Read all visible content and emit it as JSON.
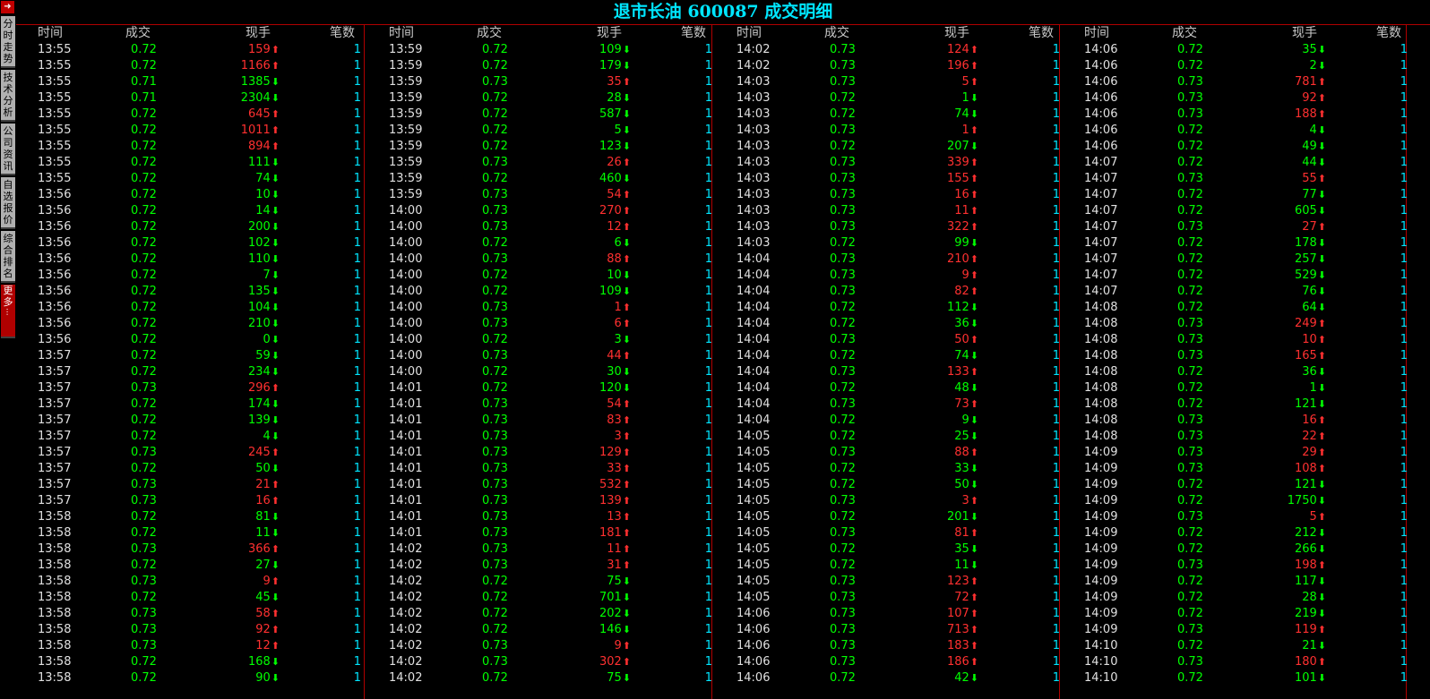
{
  "title": "退市长油 600087 成交明细",
  "sidebar": {
    "tabs": [
      "分时走势",
      "技术分析",
      "公司资讯",
      "自选报价",
      "综合排名"
    ],
    "more": "更多..."
  },
  "headers": {
    "time": "时间",
    "price": "成交",
    "volume": "现手",
    "count": "笔数"
  },
  "colors": {
    "up": "#ff3030",
    "down": "#00ff00",
    "title": "#00e6ff",
    "divider": "#b00000"
  },
  "panels": [
    [
      [
        "13:55",
        "0.72",
        "159",
        "up",
        "1"
      ],
      [
        "13:55",
        "0.72",
        "1166",
        "up",
        "1"
      ],
      [
        "13:55",
        "0.71",
        "1385",
        "down",
        "1"
      ],
      [
        "13:55",
        "0.71",
        "2304",
        "down",
        "1"
      ],
      [
        "13:55",
        "0.72",
        "645",
        "up",
        "1"
      ],
      [
        "13:55",
        "0.72",
        "1011",
        "up",
        "1"
      ],
      [
        "13:55",
        "0.72",
        "894",
        "up",
        "1"
      ],
      [
        "13:55",
        "0.72",
        "111",
        "down",
        "1"
      ],
      [
        "13:55",
        "0.72",
        "74",
        "down",
        "1"
      ],
      [
        "13:56",
        "0.72",
        "10",
        "down",
        "1"
      ],
      [
        "13:56",
        "0.72",
        "14",
        "down",
        "1"
      ],
      [
        "13:56",
        "0.72",
        "200",
        "down",
        "1"
      ],
      [
        "13:56",
        "0.72",
        "102",
        "down",
        "1"
      ],
      [
        "13:56",
        "0.72",
        "110",
        "down",
        "1"
      ],
      [
        "13:56",
        "0.72",
        "7",
        "down",
        "1"
      ],
      [
        "13:56",
        "0.72",
        "135",
        "down",
        "1"
      ],
      [
        "13:56",
        "0.72",
        "104",
        "down",
        "1"
      ],
      [
        "13:56",
        "0.72",
        "210",
        "down",
        "1"
      ],
      [
        "13:56",
        "0.72",
        "0",
        "down",
        "1"
      ],
      [
        "13:57",
        "0.72",
        "59",
        "down",
        "1"
      ],
      [
        "13:57",
        "0.72",
        "234",
        "down",
        "1"
      ],
      [
        "13:57",
        "0.73",
        "296",
        "up",
        "1"
      ],
      [
        "13:57",
        "0.72",
        "174",
        "down",
        "1"
      ],
      [
        "13:57",
        "0.72",
        "139",
        "down",
        "1"
      ],
      [
        "13:57",
        "0.72",
        "4",
        "down",
        "1"
      ],
      [
        "13:57",
        "0.73",
        "245",
        "up",
        "1"
      ],
      [
        "13:57",
        "0.72",
        "50",
        "down",
        "1"
      ],
      [
        "13:57",
        "0.73",
        "21",
        "up",
        "1"
      ],
      [
        "13:57",
        "0.73",
        "16",
        "up",
        "1"
      ],
      [
        "13:58",
        "0.72",
        "81",
        "down",
        "1"
      ],
      [
        "13:58",
        "0.72",
        "11",
        "down",
        "1"
      ],
      [
        "13:58",
        "0.73",
        "366",
        "up",
        "1"
      ],
      [
        "13:58",
        "0.72",
        "27",
        "down",
        "1"
      ],
      [
        "13:58",
        "0.73",
        "9",
        "up",
        "1"
      ],
      [
        "13:58",
        "0.72",
        "45",
        "down",
        "1"
      ],
      [
        "13:58",
        "0.73",
        "58",
        "up",
        "1"
      ],
      [
        "13:58",
        "0.73",
        "92",
        "up",
        "1"
      ],
      [
        "13:58",
        "0.73",
        "12",
        "up",
        "1"
      ],
      [
        "13:58",
        "0.72",
        "168",
        "down",
        "1"
      ],
      [
        "13:58",
        "0.72",
        "90",
        "down",
        "1"
      ]
    ],
    [
      [
        "13:59",
        "0.72",
        "109",
        "down",
        "1"
      ],
      [
        "13:59",
        "0.72",
        "179",
        "down",
        "1"
      ],
      [
        "13:59",
        "0.73",
        "35",
        "up",
        "1"
      ],
      [
        "13:59",
        "0.72",
        "28",
        "down",
        "1"
      ],
      [
        "13:59",
        "0.72",
        "587",
        "down",
        "1"
      ],
      [
        "13:59",
        "0.72",
        "5",
        "down",
        "1"
      ],
      [
        "13:59",
        "0.72",
        "123",
        "down",
        "1"
      ],
      [
        "13:59",
        "0.73",
        "26",
        "up",
        "1"
      ],
      [
        "13:59",
        "0.72",
        "460",
        "down",
        "1"
      ],
      [
        "13:59",
        "0.73",
        "54",
        "up",
        "1"
      ],
      [
        "14:00",
        "0.73",
        "270",
        "up",
        "1"
      ],
      [
        "14:00",
        "0.73",
        "12",
        "up",
        "1"
      ],
      [
        "14:00",
        "0.72",
        "6",
        "down",
        "1"
      ],
      [
        "14:00",
        "0.73",
        "88",
        "up",
        "1"
      ],
      [
        "14:00",
        "0.72",
        "10",
        "down",
        "1"
      ],
      [
        "14:00",
        "0.72",
        "109",
        "down",
        "1"
      ],
      [
        "14:00",
        "0.73",
        "1",
        "up",
        "1"
      ],
      [
        "14:00",
        "0.73",
        "6",
        "up",
        "1"
      ],
      [
        "14:00",
        "0.72",
        "3",
        "down",
        "1"
      ],
      [
        "14:00",
        "0.73",
        "44",
        "up",
        "1"
      ],
      [
        "14:00",
        "0.72",
        "30",
        "down",
        "1"
      ],
      [
        "14:01",
        "0.72",
        "120",
        "down",
        "1"
      ],
      [
        "14:01",
        "0.73",
        "54",
        "up",
        "1"
      ],
      [
        "14:01",
        "0.73",
        "83",
        "up",
        "1"
      ],
      [
        "14:01",
        "0.73",
        "3",
        "up",
        "1"
      ],
      [
        "14:01",
        "0.73",
        "129",
        "up",
        "1"
      ],
      [
        "14:01",
        "0.73",
        "33",
        "up",
        "1"
      ],
      [
        "14:01",
        "0.73",
        "532",
        "up",
        "1"
      ],
      [
        "14:01",
        "0.73",
        "139",
        "up",
        "1"
      ],
      [
        "14:01",
        "0.73",
        "13",
        "up",
        "1"
      ],
      [
        "14:01",
        "0.73",
        "181",
        "up",
        "1"
      ],
      [
        "14:02",
        "0.73",
        "11",
        "up",
        "1"
      ],
      [
        "14:02",
        "0.73",
        "31",
        "up",
        "1"
      ],
      [
        "14:02",
        "0.72",
        "75",
        "down",
        "1"
      ],
      [
        "14:02",
        "0.72",
        "701",
        "down",
        "1"
      ],
      [
        "14:02",
        "0.72",
        "202",
        "down",
        "1"
      ],
      [
        "14:02",
        "0.72",
        "146",
        "down",
        "1"
      ],
      [
        "14:02",
        "0.73",
        "9",
        "up",
        "1"
      ],
      [
        "14:02",
        "0.73",
        "302",
        "up",
        "1"
      ],
      [
        "14:02",
        "0.72",
        "75",
        "down",
        "1"
      ]
    ],
    [
      [
        "14:02",
        "0.73",
        "124",
        "up",
        "1"
      ],
      [
        "14:02",
        "0.73",
        "196",
        "up",
        "1"
      ],
      [
        "14:03",
        "0.73",
        "5",
        "up",
        "1"
      ],
      [
        "14:03",
        "0.72",
        "1",
        "down",
        "1"
      ],
      [
        "14:03",
        "0.72",
        "74",
        "down",
        "1"
      ],
      [
        "14:03",
        "0.73",
        "1",
        "up",
        "1"
      ],
      [
        "14:03",
        "0.72",
        "207",
        "down",
        "1"
      ],
      [
        "14:03",
        "0.73",
        "339",
        "up",
        "1"
      ],
      [
        "14:03",
        "0.73",
        "155",
        "up",
        "1"
      ],
      [
        "14:03",
        "0.73",
        "16",
        "up",
        "1"
      ],
      [
        "14:03",
        "0.73",
        "11",
        "up",
        "1"
      ],
      [
        "14:03",
        "0.73",
        "322",
        "up",
        "1"
      ],
      [
        "14:03",
        "0.72",
        "99",
        "down",
        "1"
      ],
      [
        "14:04",
        "0.73",
        "210",
        "up",
        "1"
      ],
      [
        "14:04",
        "0.73",
        "9",
        "up",
        "1"
      ],
      [
        "14:04",
        "0.73",
        "82",
        "up",
        "1"
      ],
      [
        "14:04",
        "0.72",
        "112",
        "down",
        "1"
      ],
      [
        "14:04",
        "0.72",
        "36",
        "down",
        "1"
      ],
      [
        "14:04",
        "0.73",
        "50",
        "up",
        "1"
      ],
      [
        "14:04",
        "0.72",
        "74",
        "down",
        "1"
      ],
      [
        "14:04",
        "0.73",
        "133",
        "up",
        "1"
      ],
      [
        "14:04",
        "0.72",
        "48",
        "down",
        "1"
      ],
      [
        "14:04",
        "0.73",
        "73",
        "up",
        "1"
      ],
      [
        "14:04",
        "0.72",
        "9",
        "down",
        "1"
      ],
      [
        "14:05",
        "0.72",
        "25",
        "down",
        "1"
      ],
      [
        "14:05",
        "0.73",
        "88",
        "up",
        "1"
      ],
      [
        "14:05",
        "0.72",
        "33",
        "down",
        "1"
      ],
      [
        "14:05",
        "0.72",
        "50",
        "down",
        "1"
      ],
      [
        "14:05",
        "0.73",
        "3",
        "up",
        "1"
      ],
      [
        "14:05",
        "0.72",
        "201",
        "down",
        "1"
      ],
      [
        "14:05",
        "0.73",
        "81",
        "up",
        "1"
      ],
      [
        "14:05",
        "0.72",
        "35",
        "down",
        "1"
      ],
      [
        "14:05",
        "0.72",
        "11",
        "down",
        "1"
      ],
      [
        "14:05",
        "0.73",
        "123",
        "up",
        "1"
      ],
      [
        "14:05",
        "0.73",
        "72",
        "up",
        "1"
      ],
      [
        "14:06",
        "0.73",
        "107",
        "up",
        "1"
      ],
      [
        "14:06",
        "0.73",
        "713",
        "up",
        "1"
      ],
      [
        "14:06",
        "0.73",
        "183",
        "up",
        "1"
      ],
      [
        "14:06",
        "0.73",
        "186",
        "up",
        "1"
      ],
      [
        "14:06",
        "0.72",
        "42",
        "down",
        "1"
      ]
    ],
    [
      [
        "14:06",
        "0.72",
        "35",
        "down",
        "1"
      ],
      [
        "14:06",
        "0.72",
        "2",
        "down",
        "1"
      ],
      [
        "14:06",
        "0.73",
        "781",
        "up",
        "1"
      ],
      [
        "14:06",
        "0.73",
        "92",
        "up",
        "1"
      ],
      [
        "14:06",
        "0.73",
        "188",
        "up",
        "1"
      ],
      [
        "14:06",
        "0.72",
        "4",
        "down",
        "1"
      ],
      [
        "14:06",
        "0.72",
        "49",
        "down",
        "1"
      ],
      [
        "14:07",
        "0.72",
        "44",
        "down",
        "1"
      ],
      [
        "14:07",
        "0.73",
        "55",
        "up",
        "1"
      ],
      [
        "14:07",
        "0.72",
        "77",
        "down",
        "1"
      ],
      [
        "14:07",
        "0.72",
        "605",
        "down",
        "1"
      ],
      [
        "14:07",
        "0.73",
        "27",
        "up",
        "1"
      ],
      [
        "14:07",
        "0.72",
        "178",
        "down",
        "1"
      ],
      [
        "14:07",
        "0.72",
        "257",
        "down",
        "1"
      ],
      [
        "14:07",
        "0.72",
        "529",
        "down",
        "1"
      ],
      [
        "14:07",
        "0.72",
        "76",
        "down",
        "1"
      ],
      [
        "14:08",
        "0.72",
        "64",
        "down",
        "1"
      ],
      [
        "14:08",
        "0.73",
        "249",
        "up",
        "1"
      ],
      [
        "14:08",
        "0.73",
        "10",
        "up",
        "1"
      ],
      [
        "14:08",
        "0.73",
        "165",
        "up",
        "1"
      ],
      [
        "14:08",
        "0.72",
        "36",
        "down",
        "1"
      ],
      [
        "14:08",
        "0.72",
        "1",
        "down",
        "1"
      ],
      [
        "14:08",
        "0.72",
        "121",
        "down",
        "1"
      ],
      [
        "14:08",
        "0.73",
        "16",
        "up",
        "1"
      ],
      [
        "14:08",
        "0.73",
        "22",
        "up",
        "1"
      ],
      [
        "14:09",
        "0.73",
        "29",
        "up",
        "1"
      ],
      [
        "14:09",
        "0.73",
        "108",
        "up",
        "1"
      ],
      [
        "14:09",
        "0.72",
        "121",
        "down",
        "1"
      ],
      [
        "14:09",
        "0.72",
        "1750",
        "down",
        "1"
      ],
      [
        "14:09",
        "0.73",
        "5",
        "up",
        "1"
      ],
      [
        "14:09",
        "0.72",
        "212",
        "down",
        "1"
      ],
      [
        "14:09",
        "0.72",
        "266",
        "down",
        "1"
      ],
      [
        "14:09",
        "0.73",
        "198",
        "up",
        "1"
      ],
      [
        "14:09",
        "0.72",
        "117",
        "down",
        "1"
      ],
      [
        "14:09",
        "0.72",
        "28",
        "down",
        "1"
      ],
      [
        "14:09",
        "0.72",
        "219",
        "down",
        "1"
      ],
      [
        "14:09",
        "0.73",
        "119",
        "up",
        "1"
      ],
      [
        "14:10",
        "0.72",
        "21",
        "down",
        "1"
      ],
      [
        "14:10",
        "0.73",
        "180",
        "up",
        "1"
      ],
      [
        "14:10",
        "0.72",
        "101",
        "down",
        "1"
      ]
    ]
  ]
}
